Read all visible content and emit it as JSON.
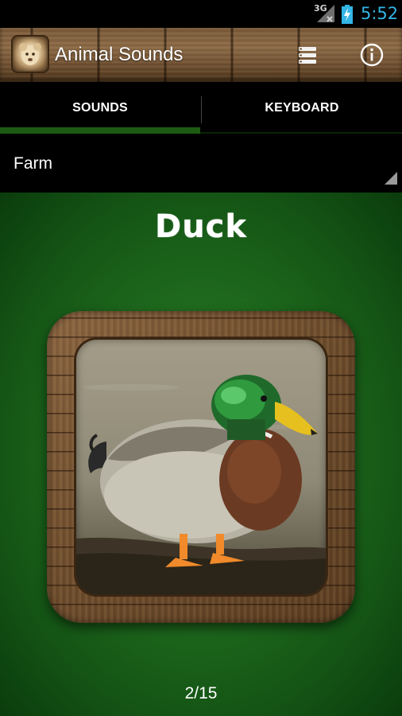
{
  "status_bar": {
    "network": "3G",
    "time": "5:52",
    "clock_color": "#33b5e5",
    "icons": [
      "signal-icon",
      "battery-charging-icon"
    ]
  },
  "action_bar": {
    "title": "Animal Sounds",
    "icons": [
      "app-icon",
      "menu-list-icon",
      "info-icon"
    ]
  },
  "tabs": [
    {
      "label": "SOUNDS",
      "selected": true
    },
    {
      "label": "KEYBOARD",
      "selected": false
    }
  ],
  "category_spinner": {
    "selected": "Farm"
  },
  "main": {
    "animal_name": "Duck",
    "image_icon": "duck-photo",
    "counter": "2/15",
    "background_color": "#1f6a1e"
  },
  "colors": {
    "accent_green": "#1c5c12",
    "text": "#ffffff"
  }
}
